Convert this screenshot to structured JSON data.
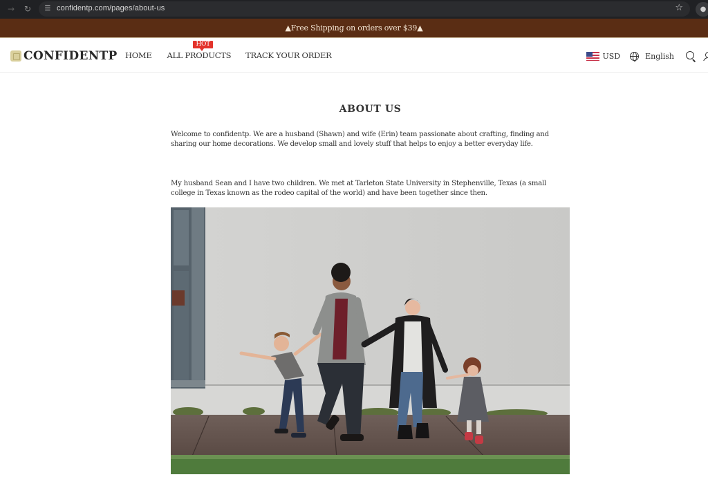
{
  "browser": {
    "url": "confidentp.com/pages/about-us",
    "icons": {
      "forward": "arrow-right-icon",
      "reload": "reload-icon",
      "site_info": "tune-icon",
      "bookmark": "star-icon",
      "profile": "profile-icon"
    }
  },
  "announcement": {
    "text": "Free Shipping on orders over $39",
    "icon": "fire-icon"
  },
  "header": {
    "logo_text": "CONFIDENTP",
    "nav": [
      {
        "label": "HOME"
      },
      {
        "label": "ALL PRODUCTS",
        "badge": "HOT"
      },
      {
        "label": "TRACK YOUR ORDER"
      }
    ],
    "currency": "USD",
    "language": "English",
    "icons": {
      "flag": "us-flag-icon",
      "language": "globe-icon",
      "search": "search-icon",
      "account": "user-icon"
    },
    "badge_color": "#e3332b"
  },
  "content": {
    "title": "ABOUT US",
    "paragraphs": [
      "Welcome to confidentp. We are a husband (Shawn) and wife (Erin) team passionate about crafting, finding and sharing our home decorations. We develop small and lovely stuff that helps to enjoy a better everyday life.",
      "My husband Sean and I have two children. We met at Tarleton State University in Stephenville, Texas (a small college in Texas known as the rodeo capital of the world) and have been together since then."
    ],
    "photo_alt": "Family of four holding hands walking along a sidewalk in front of a white wall"
  },
  "colors": {
    "announcement_bg": "#5a2d14",
    "announcement_text": "#f4e6d4",
    "browser_bg": "#202124"
  }
}
